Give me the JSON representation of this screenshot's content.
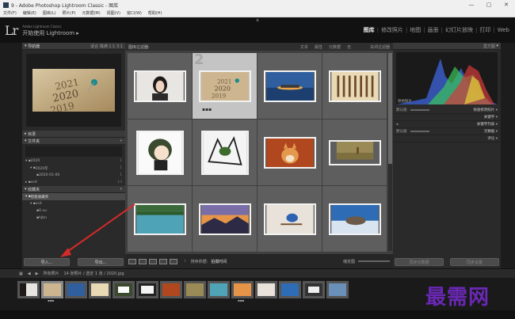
{
  "window": {
    "title": "9 - Adobe Photoshop Lightroom Classic - 图库",
    "controls": [
      "—",
      "▢",
      "✕"
    ]
  },
  "menubar": [
    "文件(F)",
    "编辑(E)",
    "图库(L)",
    "照片(P)",
    "元数据(M)",
    "视图(V)",
    "窗口(W)",
    "帮助(H)"
  ],
  "app": {
    "logo": "Lr",
    "edition": "Adobe Lightroom Classic",
    "signin": "开始使用 Lightroom ▸"
  },
  "modules": [
    "图库",
    "修改照片",
    "地图",
    "画册",
    "幻灯片放映",
    "打印",
    "Web"
  ],
  "active_module": "图库",
  "left_panel": {
    "navigator_title": "导航器",
    "navigator_opts": "适合  填满  1:1  3:1",
    "catalog_title": "目录",
    "folders_title": "文件夹",
    "folders": [
      {
        "label": "2020",
        "count": "1"
      },
      {
        "label": "2020年",
        "count": "1"
      },
      {
        "label": "2020-01-06",
        "count": "1"
      },
      {
        "label": "vsd",
        "count": "13"
      }
    ],
    "collections_title": "收藏夹",
    "collections": [
      {
        "label": "智能收藏夹"
      },
      {
        "label": "vsd"
      },
      {
        "label": "6 uu"
      },
      {
        "label": "hjbn"
      }
    ],
    "import_label": "导入...",
    "export_label": "导出..."
  },
  "center": {
    "filter_label": "图库过滤器:",
    "filter_options": [
      "文本",
      "属性",
      "元数据",
      "无"
    ],
    "filter_preset": "关闭过滤器",
    "selected_index": "2",
    "toolbar_sort_label": "排序依据:",
    "toolbar_sort_value": "拍摄时间",
    "toolbar_thumb_label": "缩览图"
  },
  "right_panel": {
    "histogram_title": "直方图",
    "original_label": "原始照片",
    "quick_develop_title": "快速修改照片",
    "keywording_title": "关键字",
    "keyword_list_title": "关键字列表",
    "metadata_title": "元数据",
    "comments_title": "评论",
    "preset_label": "默认值",
    "sync_meta": "同步元数据",
    "sync_settings": "同步设置"
  },
  "filmstrip": {
    "source_label": "所有照片",
    "count_label": "14 张照片 / 选定 1 张 / 2020.jpg",
    "filter_label": "过滤器:"
  },
  "watermark": "最需网",
  "colors": {
    "accent_arrow": "#d42a2a",
    "watermark": "#6a28b5"
  }
}
